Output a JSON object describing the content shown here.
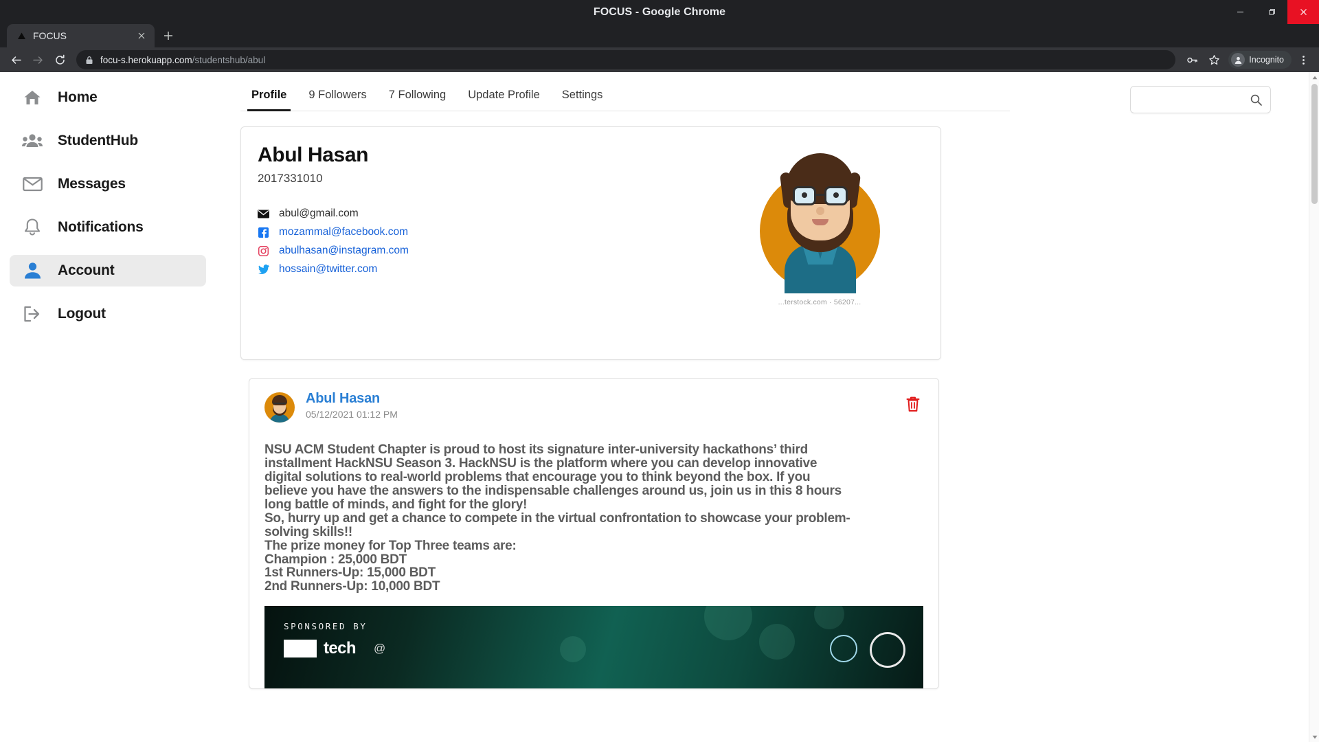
{
  "window": {
    "title": "FOCUS - Google Chrome",
    "minimize_label": "Minimize",
    "maximize_label": "Maximize",
    "close_label": "Close"
  },
  "browser": {
    "tab": {
      "title": "FOCUS",
      "favicon": "triangle-icon",
      "close_label": "×"
    },
    "new_tab_label": "+",
    "nav": {
      "back": "back-arrow-icon",
      "forward": "forward-arrow-icon",
      "reload": "reload-icon"
    },
    "omnibox": {
      "lock": "lock-icon",
      "host": "focu-s.herokuapp.com",
      "path": "/studentshub/abul",
      "full_url": "focu-s.herokuapp.com/studentshub/abul"
    },
    "profile": {
      "key_icon": "password-key-icon",
      "star_icon": "bookmark-star-icon",
      "incognito_label": "Incognito",
      "menu_icon": "kebab-menu-icon"
    }
  },
  "sidebar": {
    "items": [
      {
        "label": "Home",
        "icon": "home-icon",
        "active": false
      },
      {
        "label": "StudentHub",
        "icon": "people-group-icon",
        "active": false
      },
      {
        "label": "Messages",
        "icon": "envelope-icon",
        "active": false
      },
      {
        "label": "Notifications",
        "icon": "bell-icon",
        "active": false
      },
      {
        "label": "Account",
        "icon": "person-icon",
        "active": true
      },
      {
        "label": "Logout",
        "icon": "logout-arrow-icon",
        "active": false
      }
    ]
  },
  "search": {
    "value": "",
    "placeholder": "",
    "icon": "search-icon"
  },
  "tabs": [
    {
      "label": "Profile",
      "active": true
    },
    {
      "label": "9 Followers",
      "active": false
    },
    {
      "label": "7 Following",
      "active": false
    },
    {
      "label": "Update Profile",
      "active": false
    },
    {
      "label": "Settings",
      "active": false
    }
  ],
  "profile": {
    "name": "Abul Hasan",
    "student_id": "2017331010",
    "contacts": [
      {
        "icon": "email-icon",
        "text": "abul@gmail.com",
        "link": false
      },
      {
        "icon": "facebook-icon",
        "text": "mozammal@facebook.com",
        "link": true
      },
      {
        "icon": "instagram-icon",
        "text": "abulhasan@instagram.com",
        "link": true
      },
      {
        "icon": "twitter-icon",
        "text": "hossain@twitter.com",
        "link": true
      }
    ],
    "avatar_watermark": "...terstock.com · 56207..."
  },
  "post": {
    "author": "Abul Hasan",
    "date": "05/12/2021 01:12 PM",
    "delete_icon": "trash-icon",
    "lines": [
      "NSU ACM Student Chapter is proud to host its signature inter-university hackathons’ third",
      "installment HackNSU Season 3. HackNSU is the platform where you can develop innovative",
      "digital solutions to real-world problems that encourage you to think beyond the box. If you",
      "believe you have the answers to the indispensable challenges around us, join us in this 8 hours",
      "long battle of minds, and fight for the glory!",
      "So, hurry up and get a chance to compete in the virtual confrontation to showcase your problem-",
      "solving skills!!",
      "The prize money for Top Three teams are:",
      "Champion : 25,000 BDT",
      "1st Runners-Up: 15,000 BDT",
      "2nd Runners-Up: 10,000 BDT"
    ],
    "banner": {
      "sponsored_label": "SPONSORED BY",
      "logo_text": "tech",
      "at_text": "@"
    }
  },
  "colors": {
    "accent_blue": "#2a7fd4",
    "link_blue": "#1560d8",
    "delete_red": "#e11c1c",
    "avatar_orange": "#dc8a0a",
    "chrome_dark": "#202124"
  }
}
